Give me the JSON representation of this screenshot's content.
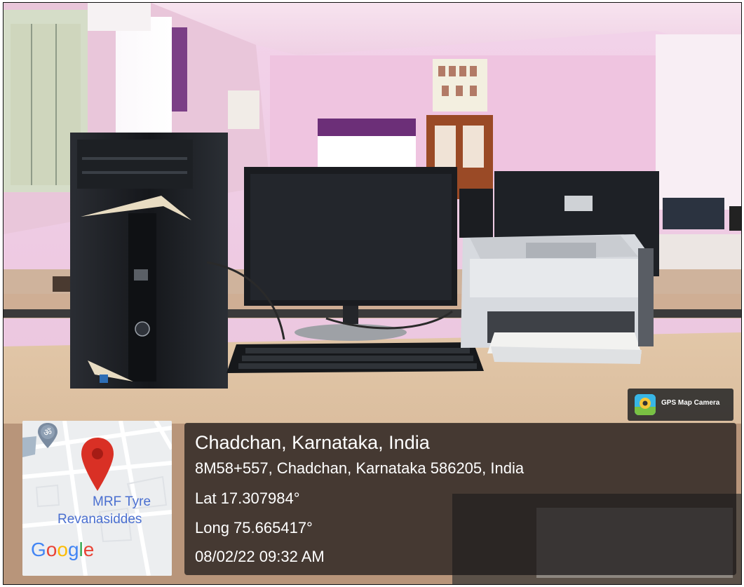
{
  "badge": {
    "app_name": "GPS Map Camera",
    "icon": "gps-map-camera-icon"
  },
  "map": {
    "labels": [
      "MRF Tyre",
      "Revanasiddes"
    ],
    "attribution": "Google",
    "marker_icon": "map-pin-icon",
    "poi_icon": "om-temple-icon"
  },
  "location": {
    "place": "Chadchan, Karnataka, India",
    "address": "8M58+557, Chadchan, Karnataka 586205, India",
    "latitude": "Lat 17.307984°",
    "longitude": "Long 75.665417°",
    "datetime": "08/02/22 09:32 AM"
  },
  "colors": {
    "marker": "#d93025",
    "google_blue": "#4285f4",
    "google_red": "#ea4335",
    "google_yellow": "#fbbc05",
    "google_green": "#34a853"
  }
}
